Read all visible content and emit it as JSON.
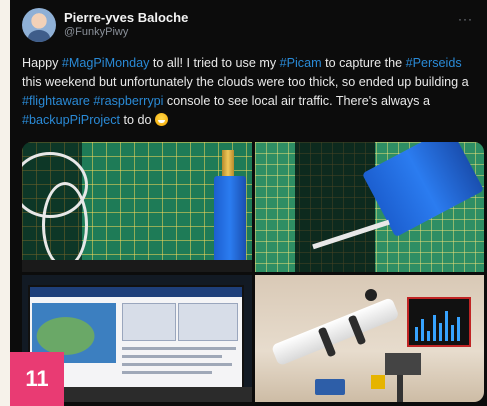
{
  "tweet": {
    "display_name": "Pierre-yves Baloche",
    "handle": "@FunkyPiwy",
    "more_icon": "more-horizontal-icon",
    "text_parts": [
      {
        "t": "Happy ",
        "hl": false
      },
      {
        "t": "#MagPiMonday",
        "hl": true
      },
      {
        "t": " to all! I tried to use my ",
        "hl": false
      },
      {
        "t": "#Picam",
        "hl": true
      },
      {
        "t": " to capture the ",
        "hl": false
      },
      {
        "t": "#Perseids",
        "hl": true
      },
      {
        "t": " this weekend but unfortunately the clouds were too thick, so ended up building a ",
        "hl": false
      },
      {
        "t": "#flightaware",
        "hl": true
      },
      {
        "t": " ",
        "hl": false
      },
      {
        "t": "#raspberrypi",
        "hl": true
      },
      {
        "t": " console to see local air traffic. There's always a ",
        "hl": false
      },
      {
        "t": "#backupPiProject",
        "hl": true
      },
      {
        "t": " to do",
        "hl": false
      }
    ],
    "emoji": "grinning-face-emoji",
    "hashtag_color": "#2a8ad6",
    "media": [
      {
        "description": "antenna-and-cable-on-cutting-mat"
      },
      {
        "description": "flightaware-blue-box-on-cutting-mat"
      },
      {
        "description": "flight-tracker-screen"
      },
      {
        "description": "telescope-with-pi-display"
      }
    ]
  },
  "badge": {
    "number": "11",
    "color": "#e93b73"
  }
}
